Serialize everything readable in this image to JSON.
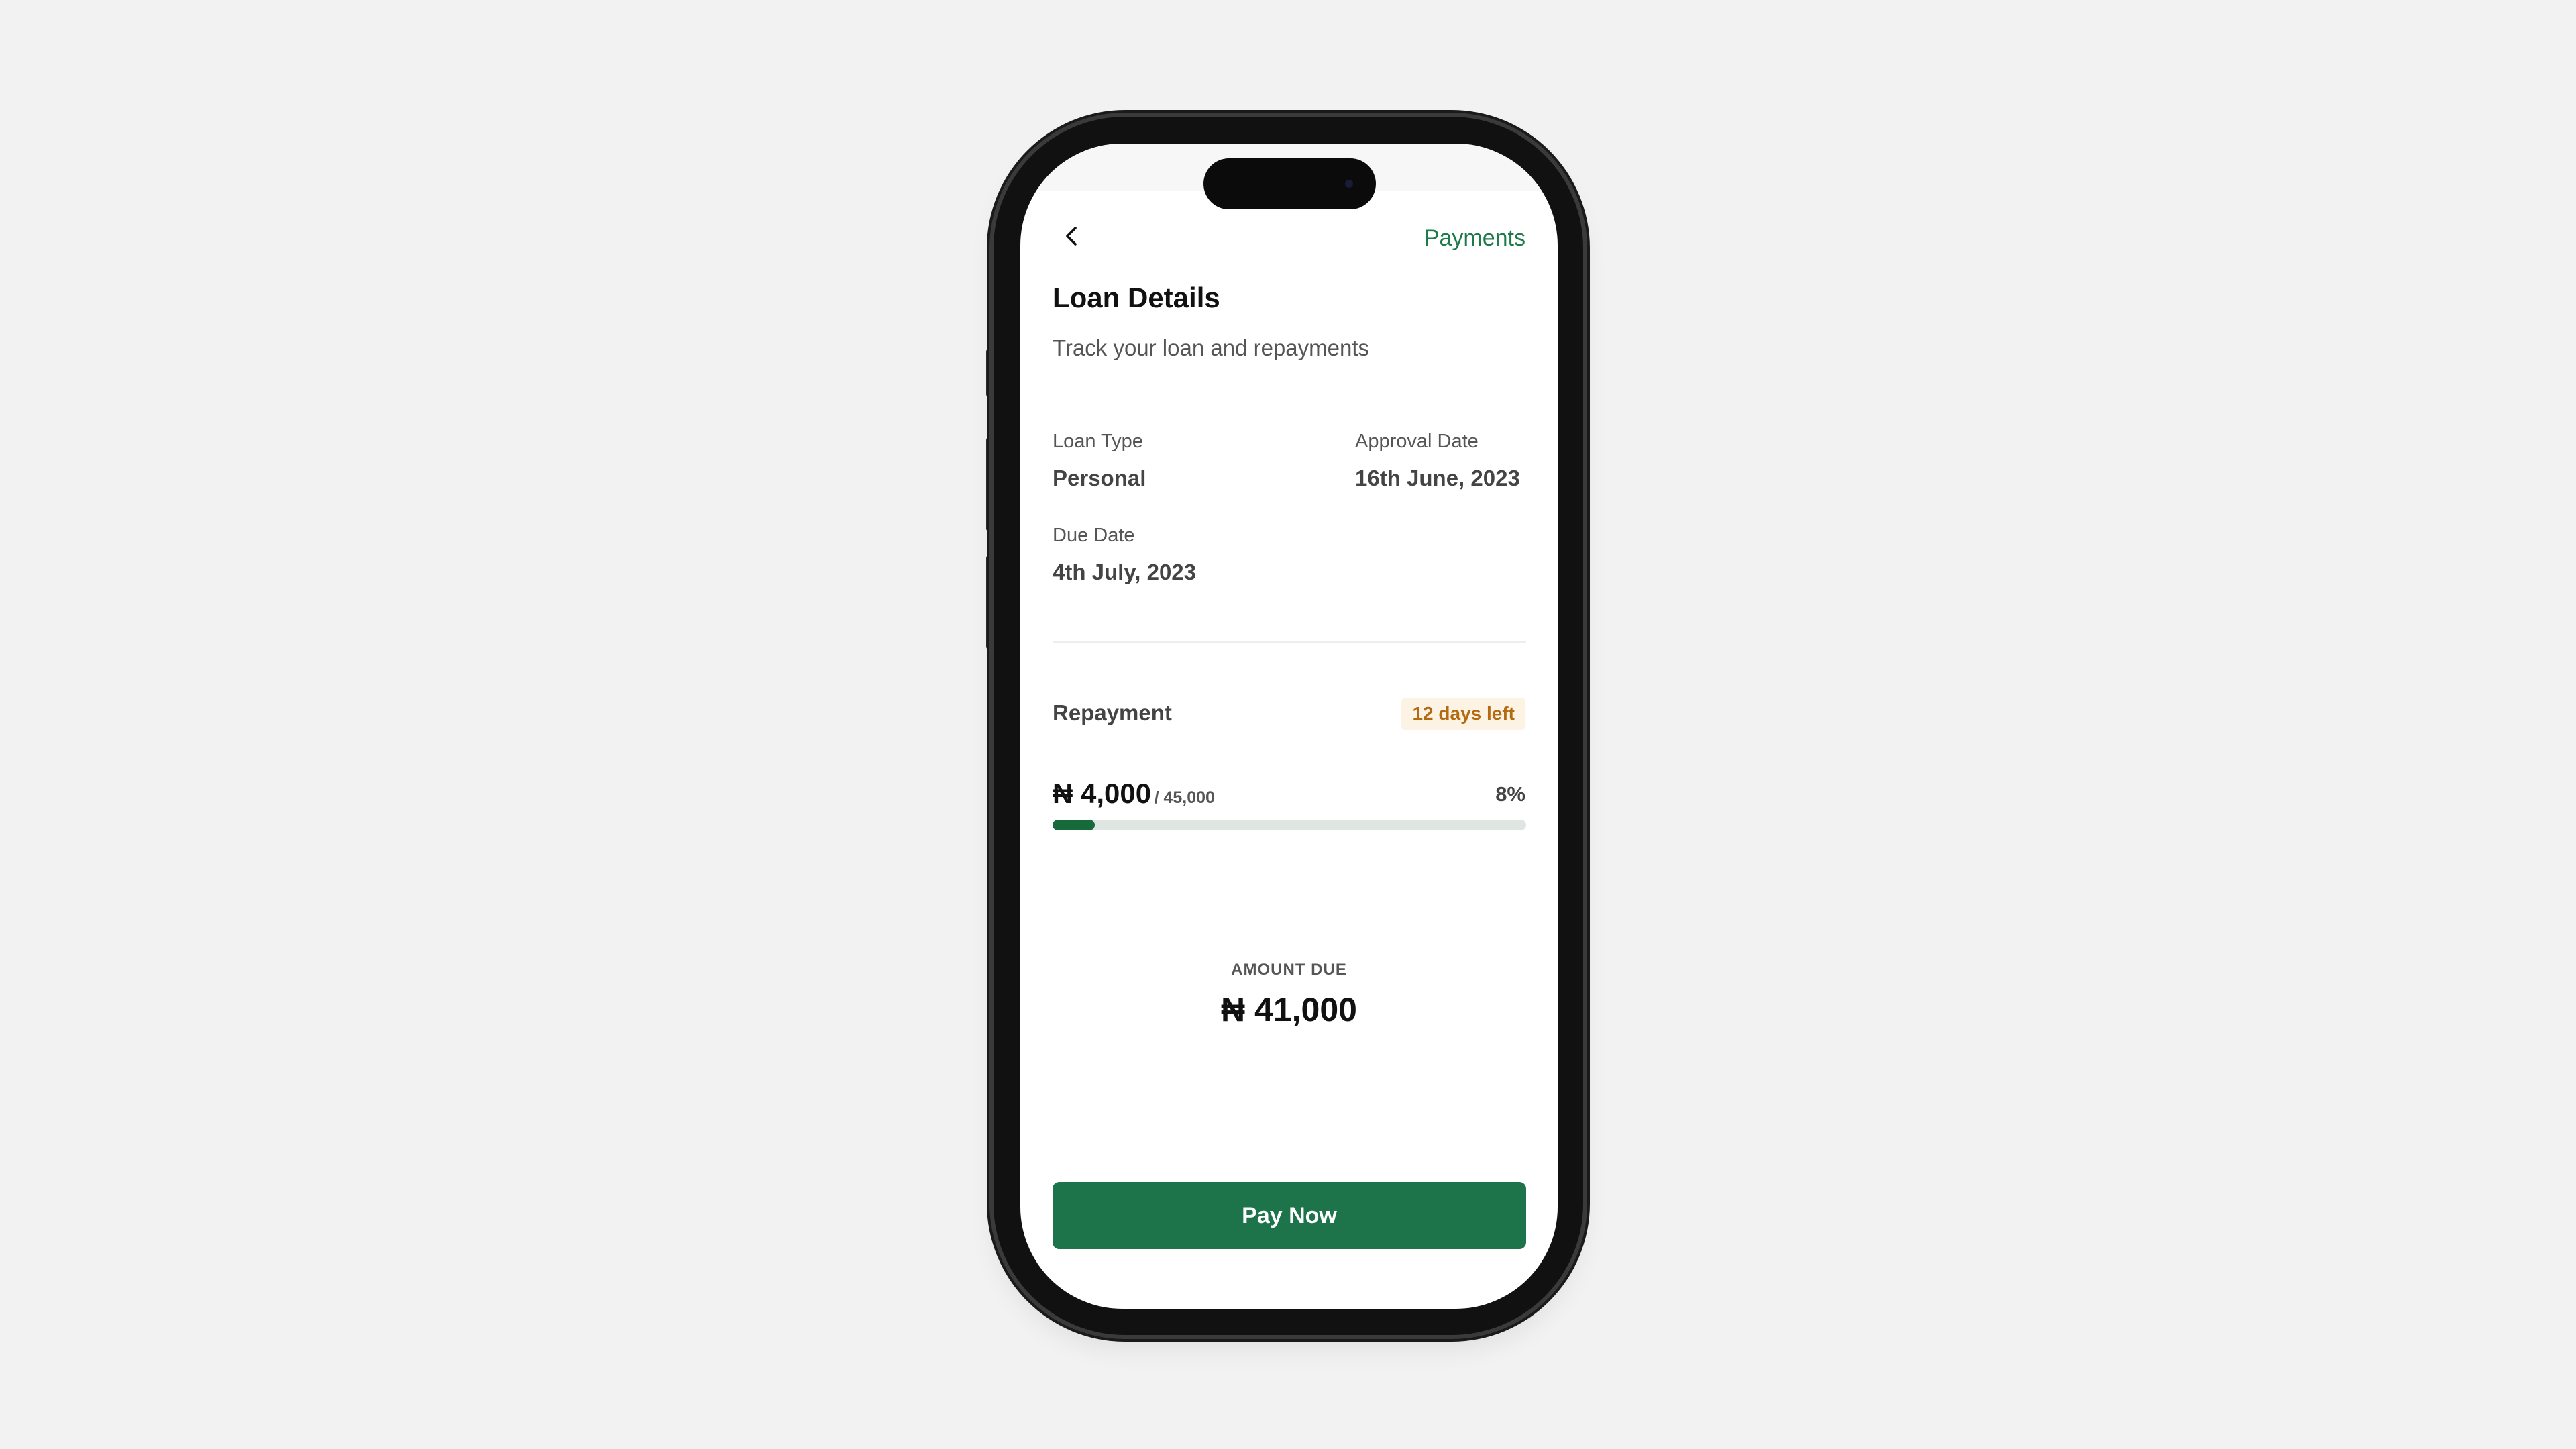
{
  "header": {
    "back_icon": "chevron-left-icon",
    "payments_link": "Payments"
  },
  "page": {
    "title": "Loan Details",
    "subtitle": "Track your loan and repayments"
  },
  "details": {
    "loan_type_label": "Loan Type",
    "loan_type_value": "Personal",
    "approval_date_label": "Approval Date",
    "approval_date_value": "16th June, 2023",
    "due_date_label": "Due Date",
    "due_date_value": "4th July, 2023"
  },
  "repayment": {
    "label": "Repayment",
    "days_left": "12 days left",
    "paid_amount": "₦ 4,000",
    "total_amount": "/ 45,000",
    "percent_label": "8%",
    "progress_fraction": 0.0889
  },
  "amount_due": {
    "label": "AMOUNT DUE",
    "value": "₦ 41,000"
  },
  "actions": {
    "pay_label": "Pay Now"
  },
  "colors": {
    "accent": "#1e744a",
    "badge_text": "#b36a10",
    "badge_bg": "#fdf3e4",
    "progress_fill": "#166a3c",
    "progress_track": "#dfe6e2"
  }
}
